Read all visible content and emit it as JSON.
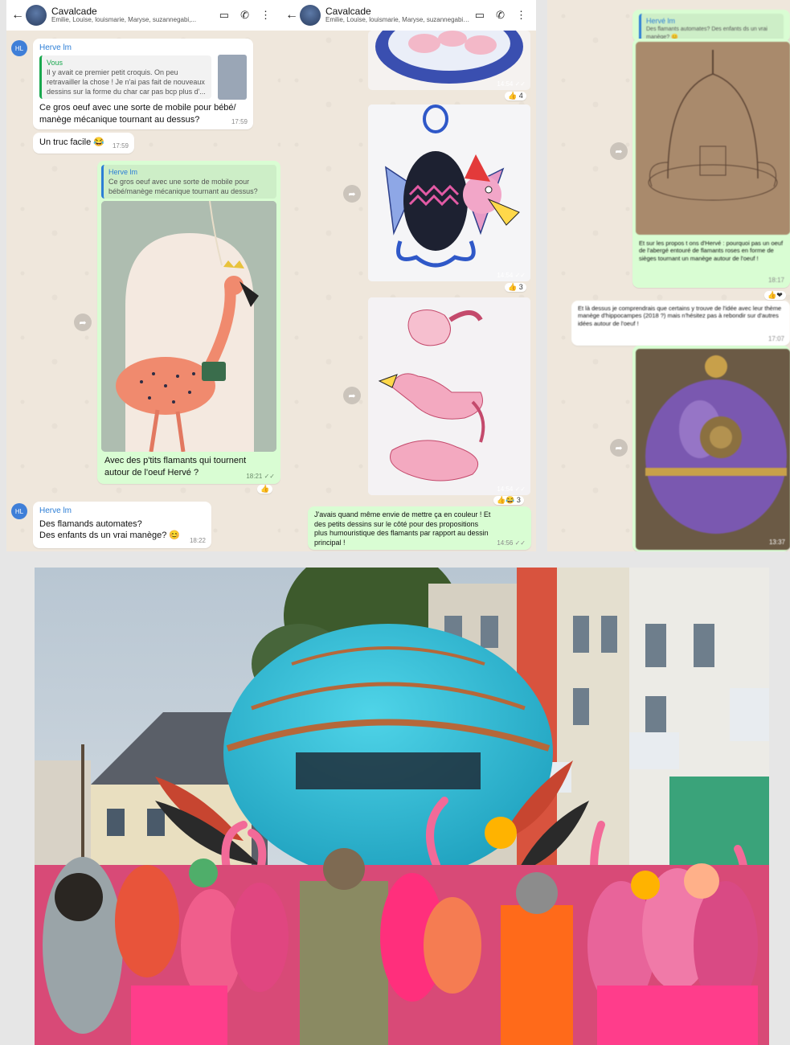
{
  "chat": {
    "title": "Cavalcade",
    "members": "Émilie, Louise, louismarie, Maryse, suzannegabi,...",
    "members_short": "Émilie, Louise, louismarie, Maryse, suzannegabi,..."
  },
  "panel1": {
    "msg1": {
      "sender": "Herve lm",
      "quote_name": "Vous",
      "quote_text": "Il y avait ce premier petit croquis. On peu retravailler la chose ! Je n'ai pas fait de nouveaux dessins sur la forme du char car pas bcp plus d'...",
      "text": "Ce gros oeuf avec une sorte de mobile pour bébé/ manège mécanique tournant au dessus?",
      "time": "17:59"
    },
    "msg2": {
      "text": "Un truc facile 😂",
      "time": "17:59"
    },
    "msg3": {
      "quote_name": "Herve lm",
      "quote_text": "Ce gros oeuf avec une sorte de mobile pour bébé/manège mécanique tournant au dessus?",
      "caption": "Avec des p'tits flamants qui tournent autour de l'oeuf Hervé ?",
      "time": "18:21 ✓✓",
      "reaction": "👍"
    },
    "msg4": {
      "sender": "Herve lm",
      "line1": "Des flamands automates?",
      "line2": "Des enfants ds un vrai manège? 😊",
      "time": "18:22"
    },
    "avatar_initials": "HL"
  },
  "panel2": {
    "img1": {
      "time": "14:54 ✓✓",
      "reaction": "👍 4"
    },
    "img2": {
      "time": "14:54 ✓✓",
      "reaction": "👍 3"
    },
    "img3": {
      "time": "14:54 ✓✓",
      "reaction": "👍😂 3"
    },
    "caption": "J'avais quand même envie de mettre ça en couleur ! Et des petits dessins sur le côté pour des propositions plus humouristique des flamants par rapport au dessin principal !",
    "caption_time": "14:56 ✓✓"
  },
  "panel3": {
    "quote_name": "Hervé lm",
    "quote_text": "Des flamants automates? Des enfants ds un vrai manège? 😊",
    "text1": "Et sur les propos t ons d'Hervé : pourquoi pas un oeuf de l'abergé entouré de flamants roses en forme de sièges tournant un manège autour de l'oeuf !",
    "text1_time": "18:17",
    "text2": "Et là dessus je comprendrais que certains y trouve de l'idée avec leur thème manège d'hippocampes (2018 ?) mais n'hésitez pas à rebondir sur d'autres idées autour de l'oeuf !",
    "text2_time": "17:07",
    "img_time": "13:37"
  },
  "colors": {
    "chat_bg": "#efe7dc",
    "incoming": "#ffffff",
    "outgoing": "#d9fdd3",
    "accent": "#2c7ed6",
    "quote_green": "#1aa84f",
    "egg_blue": "#2ec2d8",
    "flamingo_pink": "#ff3d8b"
  },
  "icons": [
    "back-arrow-icon",
    "video-call-icon",
    "phone-icon",
    "more-vertical-icon",
    "forward-icon",
    "double-check-icon"
  ]
}
